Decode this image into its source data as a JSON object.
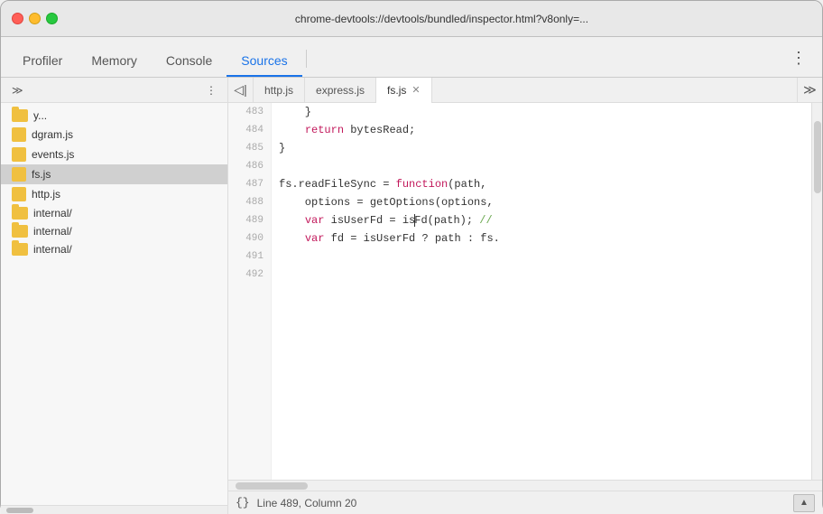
{
  "titlebar": {
    "url": "chrome-devtools://devtools/bundled/inspector.html?v8only=..."
  },
  "tabs": [
    {
      "id": "profiler",
      "label": "Profiler",
      "active": false
    },
    {
      "id": "memory",
      "label": "Memory",
      "active": false
    },
    {
      "id": "console",
      "label": "Console",
      "active": false
    },
    {
      "id": "sources",
      "label": "Sources",
      "active": true
    }
  ],
  "editor_tabs": [
    {
      "id": "http",
      "label": "http.js",
      "closeable": false,
      "active": false
    },
    {
      "id": "express",
      "label": "express.js",
      "closeable": false,
      "active": false
    },
    {
      "id": "fs",
      "label": "fs.js",
      "closeable": true,
      "active": true
    }
  ],
  "sidebar": {
    "files": [
      {
        "name": "y...",
        "type": "folder",
        "indent": 0
      },
      {
        "name": "dgram.js",
        "type": "js",
        "indent": 0
      },
      {
        "name": "events.js",
        "type": "js",
        "indent": 0
      },
      {
        "name": "fs.js",
        "type": "js",
        "indent": 0,
        "active": true
      },
      {
        "name": "http.js",
        "type": "js",
        "indent": 0
      },
      {
        "name": "internal/",
        "type": "folder",
        "indent": 0
      },
      {
        "name": "internal/",
        "type": "folder",
        "indent": 0
      },
      {
        "name": "internal/",
        "type": "folder",
        "indent": 0
      }
    ]
  },
  "code": {
    "lines": [
      {
        "num": 483,
        "text": "    }"
      },
      {
        "num": 484,
        "text": "    return bytesRead;"
      },
      {
        "num": 485,
        "text": "}"
      },
      {
        "num": 486,
        "text": ""
      },
      {
        "num": 487,
        "text": "fs.readFileSync = function(path,"
      },
      {
        "num": 488,
        "text": "    options = getOptions(options,"
      },
      {
        "num": 489,
        "text": "    var isUserFd = isFd(path); //"
      },
      {
        "num": 490,
        "text": "    var fd = isUserFd ? path : fs."
      },
      {
        "num": 491,
        "text": ""
      },
      {
        "num": 492,
        "text": ""
      }
    ]
  },
  "statusbar": {
    "braces": "{}",
    "position": "Line 489, Column 20"
  }
}
